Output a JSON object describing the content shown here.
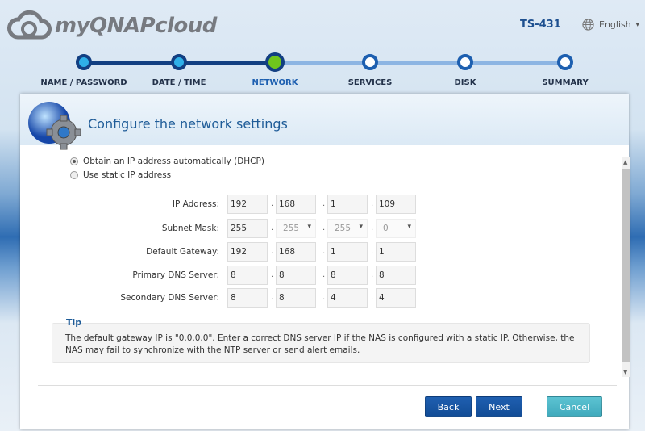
{
  "header": {
    "logo_text": "myQNAPcloud",
    "model": "TS-431",
    "language": "English"
  },
  "steps": [
    {
      "label": "NAME / PASSWORD",
      "state": "done"
    },
    {
      "label": "DATE / TIME",
      "state": "done"
    },
    {
      "label": "NETWORK",
      "state": "current"
    },
    {
      "label": "SERVICES",
      "state": "pending"
    },
    {
      "label": "DISK",
      "state": "pending"
    },
    {
      "label": "SUMMARY",
      "state": "pending"
    }
  ],
  "panel": {
    "title": "Configure the network settings"
  },
  "options": {
    "dhcp": "Obtain an IP address automatically (DHCP)",
    "static": "Use static IP address",
    "selected": "dhcp"
  },
  "fields": [
    {
      "label": "IP Address:",
      "values": [
        "192",
        "168",
        "1",
        "109"
      ]
    },
    {
      "label": "Subnet Mask:",
      "values": [
        "255",
        "255",
        "255",
        "0"
      ]
    },
    {
      "label": "Default Gateway:",
      "values": [
        "192",
        "168",
        "1",
        "1"
      ]
    },
    {
      "label": "Primary DNS Server:",
      "values": [
        "8",
        "8",
        "8",
        "8"
      ]
    },
    {
      "label": "Secondary DNS Server:",
      "values": [
        "8",
        "8",
        "4",
        "4"
      ]
    }
  ],
  "tip": {
    "title": "Tip",
    "text": "The default gateway IP is \"0.0.0.0\". Enter a correct DNS server IP if the NAS is configured with a static IP. Otherwise, the NAS may fail to synchronize with the NTP server or send alert emails."
  },
  "buttons": {
    "back": "Back",
    "next": "Next",
    "cancel": "Cancel"
  },
  "colors": {
    "accent": "#1d5fb0",
    "current_step": "#6fc51c",
    "cancel": "#4fb8c8"
  }
}
